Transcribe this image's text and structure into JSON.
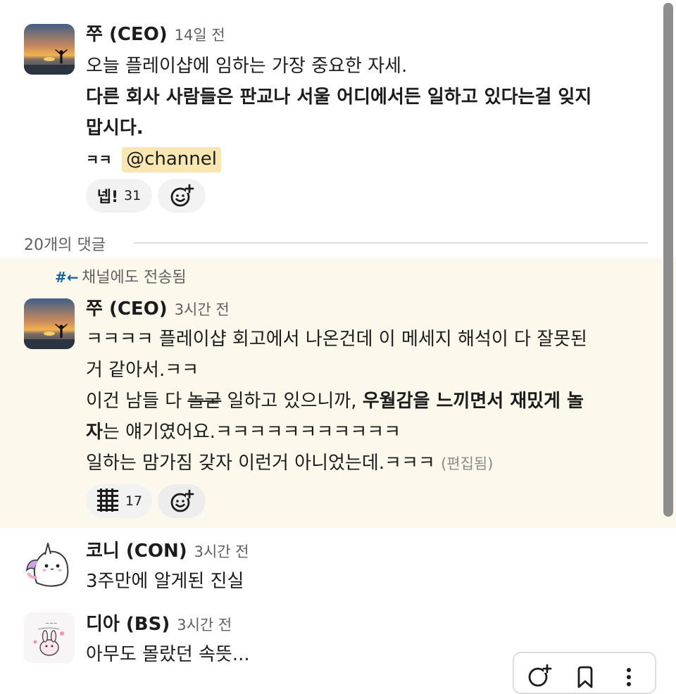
{
  "parent_message": {
    "author": "쭈 (CEO)",
    "time": "14일 전",
    "line1": "오늘 플레이샵에 임하는 가장 중요한 자세.",
    "bold_line2": "다른 회사 사람들은 판교나 서울 어디에서든 일하고 있다는걸 잊지",
    "bold_line3": "맙시다.",
    "line4_prefix": "ㅋㅋ",
    "mention": "@channel",
    "reactions": [
      {
        "emoji": "넵!",
        "count": "31"
      }
    ]
  },
  "thread_divider": {
    "label": "20개의 댓글"
  },
  "reply_ceo": {
    "also_sent_icon": "#←",
    "also_sent_label": "채널에도 전송됨",
    "author": "쭈 (CEO)",
    "time": "3시간 전",
    "line1": "ㅋㅋㅋㅋ 플레이샵 회고에서 나온건데 이 메세지 해석이 다 잘못된",
    "line2": "거 같아서.ㅋㅋ",
    "line3_a": "이건 남들 다 ",
    "line3_strike": "놀굳",
    "line3_b": " 일하고 있으니까, ",
    "line3_bold": "우월감을 느끼면서 재밌게 놀",
    "line4_bold": "자",
    "line4_rest": "는 얘기였어요.ㅋㅋㅋㅋㅋㅋㅋㅋㅋㅋㅋ",
    "line5": "일하는 맘가짐 갖자 이런거 아니었는데.ㅋㅋㅋ",
    "edited": "(편집됨)",
    "reactions": [
      {
        "emoji": "stacked-bars-emoji",
        "count": "17"
      }
    ]
  },
  "reply_koni": {
    "author": "코니 (CON)",
    "time": "3시간 전",
    "text": "3주만에 알게된 진실"
  },
  "reply_dia": {
    "author": "디아 (BS)",
    "time": "3시간 전",
    "text": "아무도 몰랐던 속뜻..."
  },
  "icons": {
    "add_reaction": "add-reaction-icon",
    "bookmark": "bookmark-icon",
    "more": "more-vertical-icon"
  },
  "colors": {
    "mention_bg": "#f8e7b0",
    "highlight_bg": "#fdf8ec",
    "link_blue": "#1264a3"
  }
}
